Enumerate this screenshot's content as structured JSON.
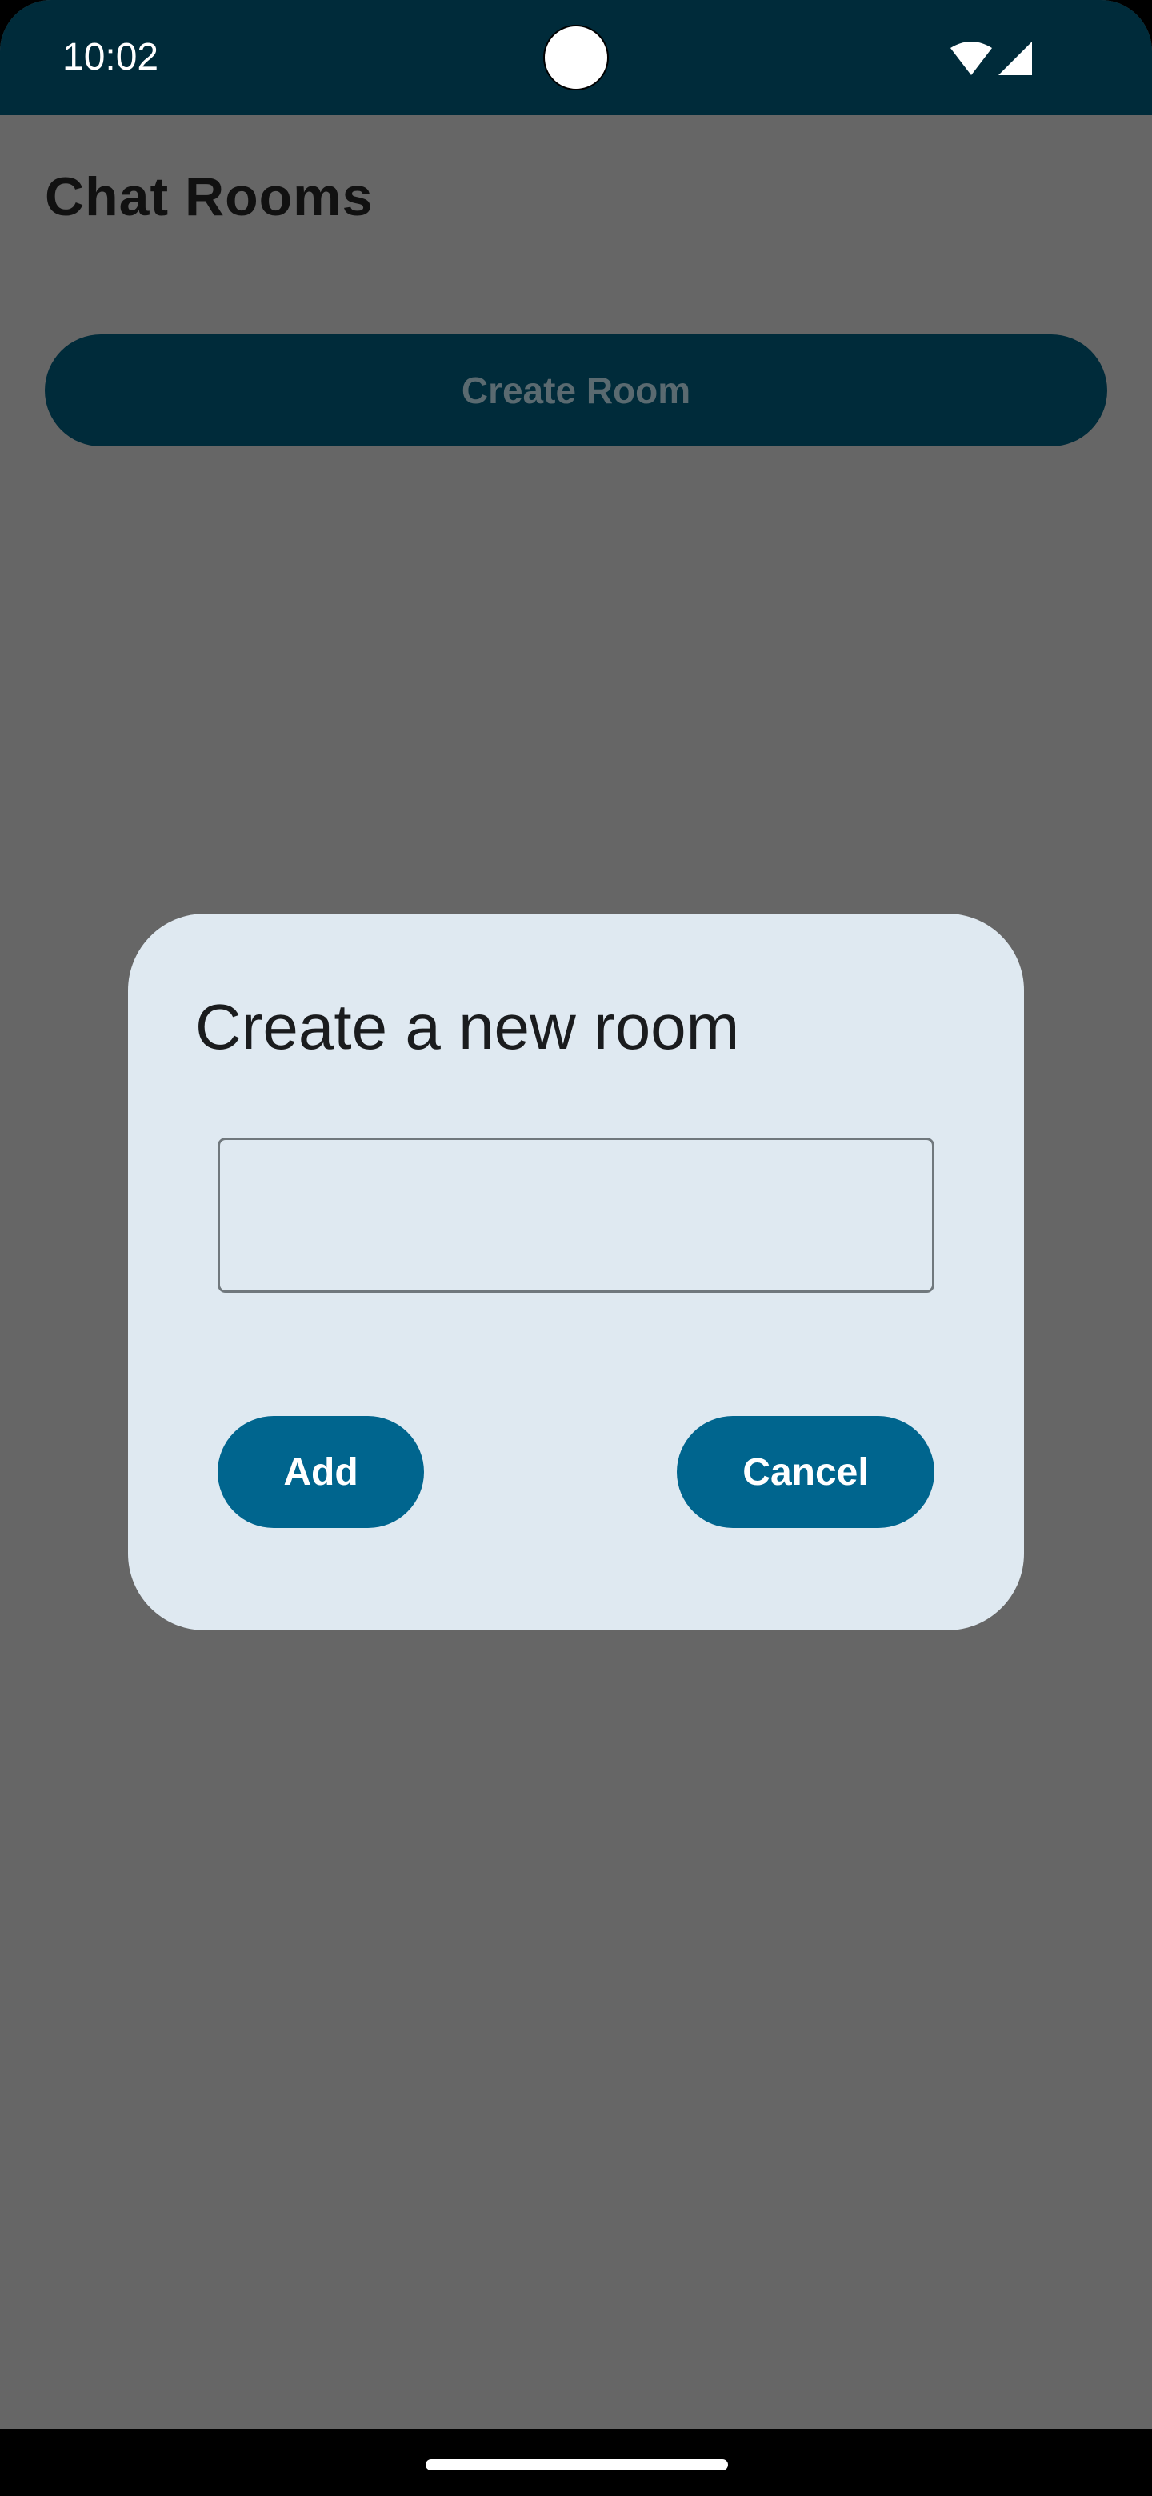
{
  "status_bar": {
    "time": "10:02",
    "icons": [
      "wifi-icon",
      "cellular-signal-icon"
    ]
  },
  "page": {
    "title": "Chat Rooms",
    "create_room_label": "Create Room"
  },
  "dialog": {
    "title": "Create a new room",
    "room_name_value": "",
    "add_label": "Add",
    "cancel_label": "Cancel"
  },
  "colors": {
    "status_bar_bg": "#002b3a",
    "scrim": "#666666",
    "dialog_bg": "#dfe9f1",
    "button_primary": "#00658e"
  }
}
